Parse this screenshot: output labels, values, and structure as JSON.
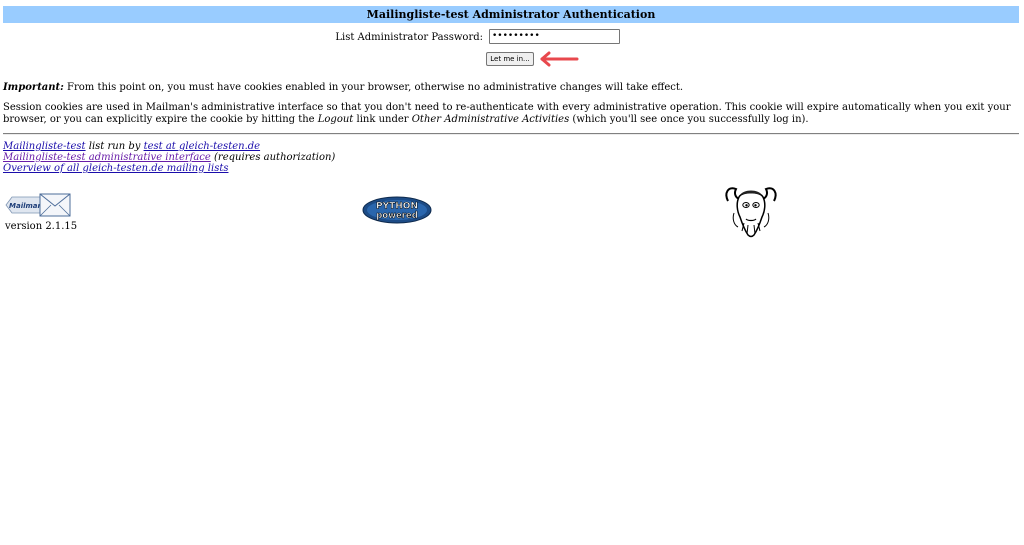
{
  "header": {
    "title": "Mailingliste-test Administrator Authentication",
    "background": "#99ccff"
  },
  "login": {
    "password_label": "List Administrator Password:",
    "password_value": "•••••••••",
    "submit_label": "Let me in..."
  },
  "annotation": {
    "arrow_color": "#e8484d",
    "icon": "left-arrow-icon"
  },
  "notice": {
    "important_label": "Important:",
    "important_text": " From this point on, you must have cookies enabled in your browser, otherwise no administrative changes will take effect.",
    "session_part1": "Session cookies are used in Mailman's administrative interface so that you don't need to re-authenticate with every administrative operation. This cookie will expire automatically when you exit your browser, or you can explicitly expire the cookie by hitting the ",
    "session_logout": "Logout",
    "session_part2": " link under ",
    "session_other": "Other Administrative Activities",
    "session_part3": " (which you'll see once you successfully log in)."
  },
  "footer": {
    "list_link": "Mailingliste-test",
    "list_run_by": " list run by ",
    "owner_link": "test at gleich-testen.de",
    "admin_link": "Mailingliste-test administrative interface",
    "admin_note": " (requires authorization)",
    "overview_link": "Overview of all gleich-testen.de mailing lists",
    "version": "version 2.1.15",
    "mailman_logo_text": "Mailman",
    "python_logo_line1": "PYTHON",
    "python_logo_line2": "powered"
  }
}
